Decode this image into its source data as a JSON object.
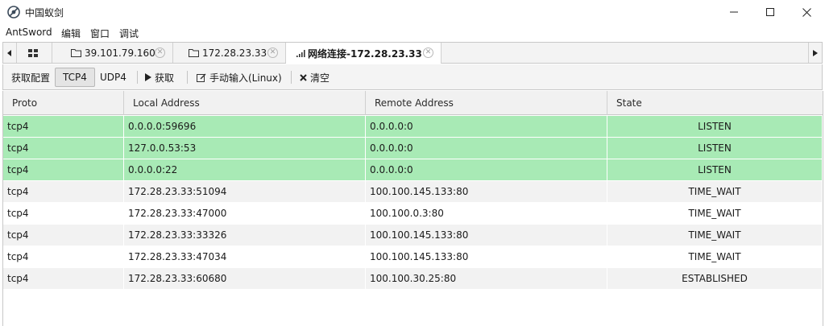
{
  "window": {
    "title": "中国蚁剑",
    "minimize_icon": "minimize-icon",
    "maximize_icon": "maximize-icon",
    "close_icon": "close-icon"
  },
  "menu": {
    "items": [
      {
        "label": "AntSword"
      },
      {
        "label": "编辑"
      },
      {
        "label": "窗口"
      },
      {
        "label": "调试"
      }
    ]
  },
  "tabs": {
    "items": [
      {
        "label": "",
        "icon": "grid-icon"
      },
      {
        "label": "39.101.79.160",
        "icon": "folder-icon"
      },
      {
        "label": "172.28.23.33",
        "icon": "folder-icon"
      },
      {
        "label": "网络连接-172.28.23.33",
        "icon": "signal-icon",
        "active": true
      }
    ]
  },
  "toolbar": {
    "get_config": "获取配置",
    "tcp4": "TCP4",
    "udp4": "UDP4",
    "fetch": "获取",
    "manual_input": "手动输入(Linux)",
    "clear": "清空"
  },
  "grid": {
    "columns": [
      "Proto",
      "Local Address",
      "Remote Address",
      "State"
    ],
    "rows": [
      {
        "proto": "tcp4",
        "local": "0.0.0.0:59696",
        "remote": "0.0.0.0:0",
        "state": "LISTEN"
      },
      {
        "proto": "tcp4",
        "local": "127.0.0.53:53",
        "remote": "0.0.0.0:0",
        "state": "LISTEN"
      },
      {
        "proto": "tcp4",
        "local": "0.0.0.0:22",
        "remote": "0.0.0.0:0",
        "state": "LISTEN"
      },
      {
        "proto": "tcp4",
        "local": "172.28.23.33:51094",
        "remote": "100.100.145.133:80",
        "state": "TIME_WAIT"
      },
      {
        "proto": "tcp4",
        "local": "172.28.23.33:47000",
        "remote": "100.100.0.3:80",
        "state": "TIME_WAIT"
      },
      {
        "proto": "tcp4",
        "local": "172.28.23.33:33326",
        "remote": "100.100.145.133:80",
        "state": "TIME_WAIT"
      },
      {
        "proto": "tcp4",
        "local": "172.28.23.33:47034",
        "remote": "100.100.145.133:80",
        "state": "TIME_WAIT"
      },
      {
        "proto": "tcp4",
        "local": "172.28.23.33:60680",
        "remote": "100.100.30.25:80",
        "state": "ESTABLISHED"
      }
    ]
  },
  "colors": {
    "listen_row": "#a8eab5",
    "alt_row": "#f2f2f2"
  }
}
